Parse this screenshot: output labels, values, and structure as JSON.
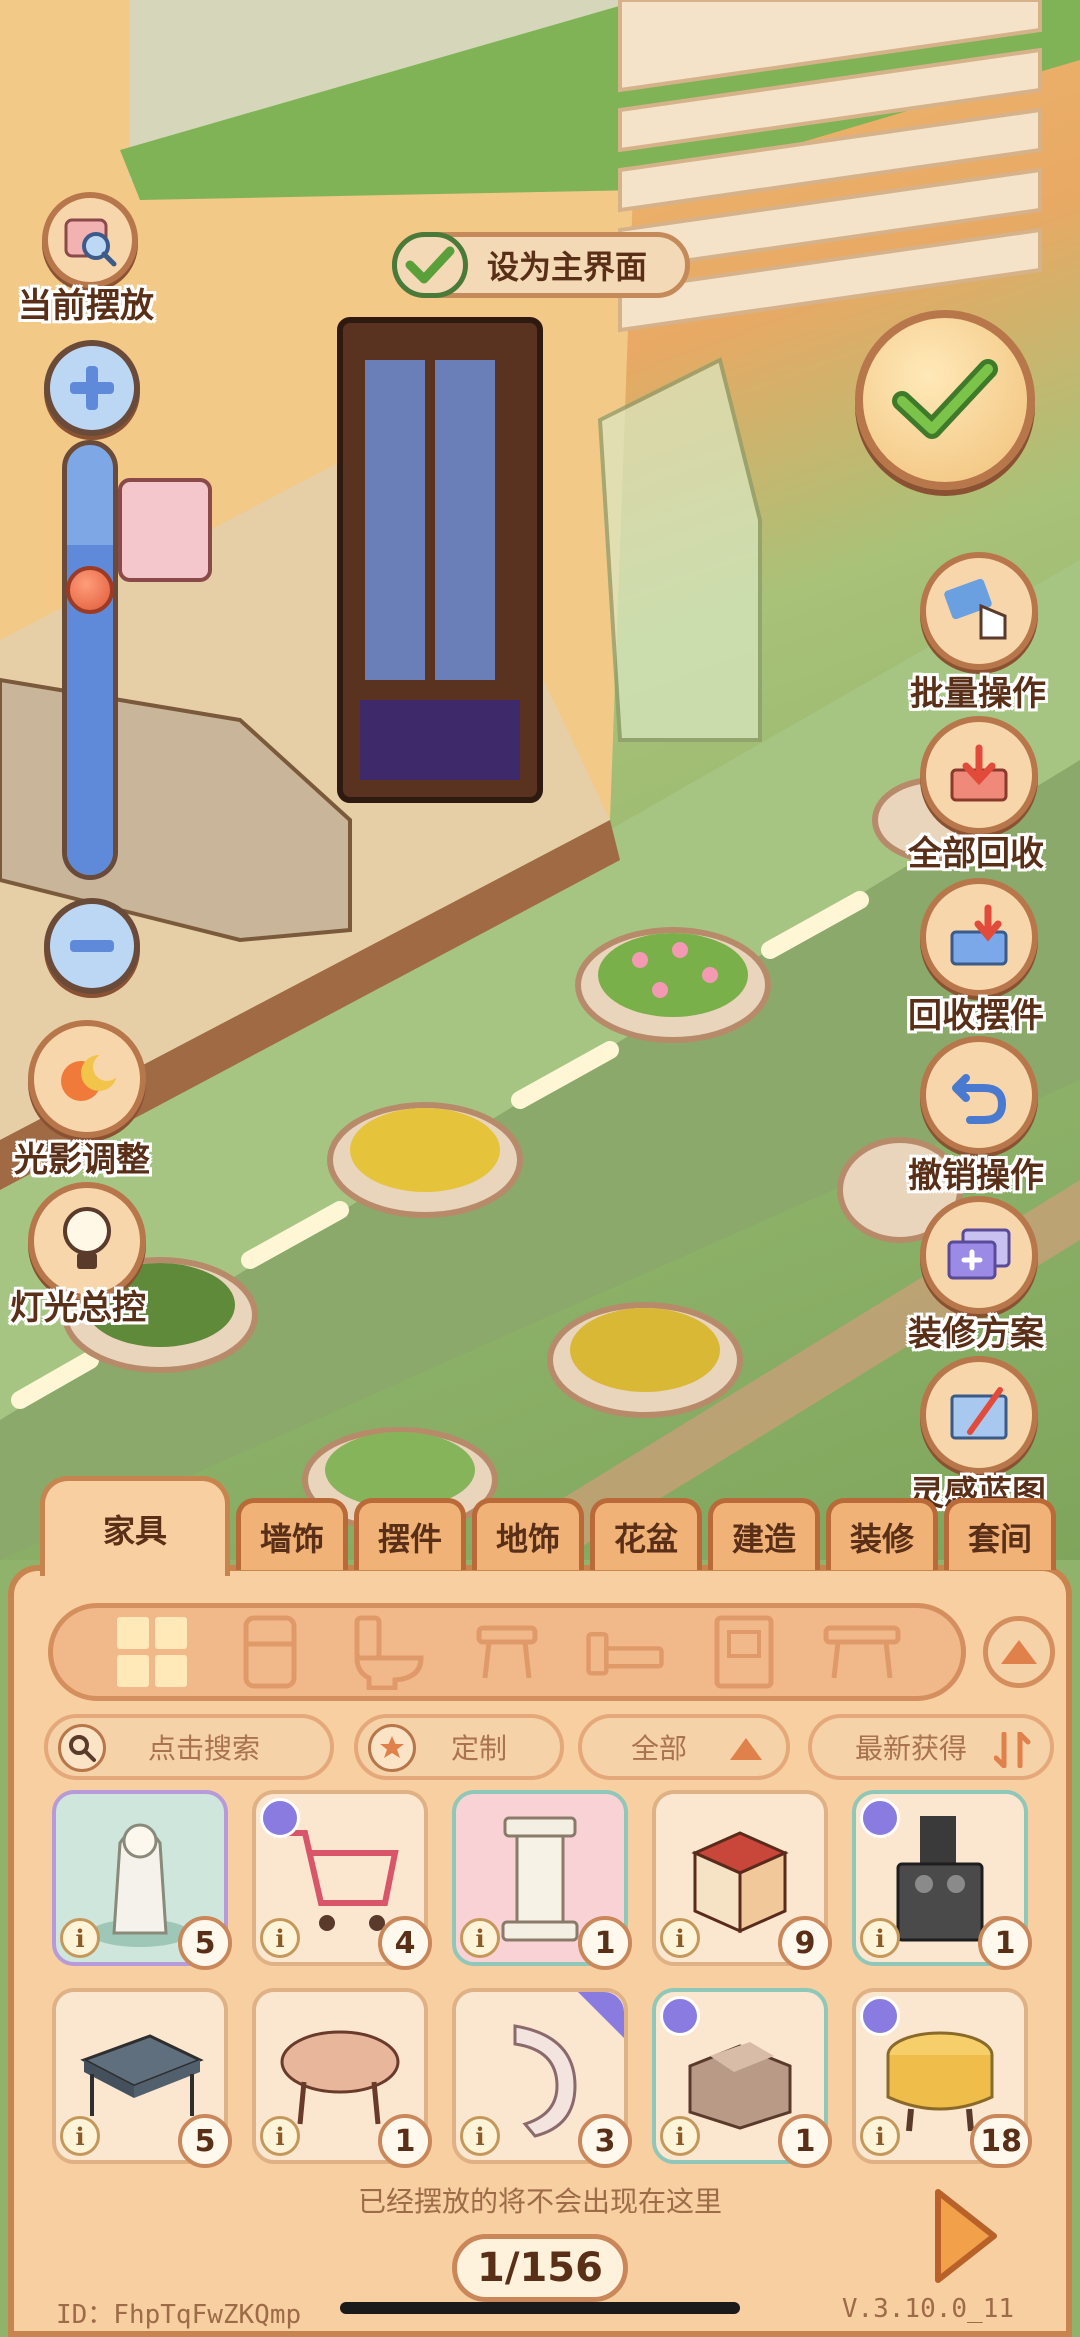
{
  "main_screen_toggle": {
    "label": "设为主界面",
    "checked": true
  },
  "left_controls": [
    {
      "id": "current",
      "label": "当前摆放",
      "icon": "magnifier-frame-icon"
    },
    {
      "id": "light_shadow",
      "label": "光影调整",
      "icon": "sun-moon-icon"
    },
    {
      "id": "light_master",
      "label": "灯光总控",
      "icon": "lightbulb-icon"
    }
  ],
  "zoom": {
    "level": 0.75
  },
  "right_controls": [
    {
      "id": "batch",
      "label": "批量操作",
      "icon": "hand-select-icon"
    },
    {
      "id": "recycle_all",
      "label": "全部回收",
      "icon": "recycle-tray-icon"
    },
    {
      "id": "recycle_item",
      "label": "回收摆件",
      "icon": "box-down-icon"
    },
    {
      "id": "undo",
      "label": "撤销操作",
      "icon": "undo-arrow-icon"
    },
    {
      "id": "plans",
      "label": "装修方案",
      "icon": "plan-cards-icon"
    },
    {
      "id": "inspiration",
      "label": "灵感蓝图",
      "icon": "blueprint-icon"
    }
  ],
  "tabs": [
    "家具",
    "墙饰",
    "摆件",
    "地饰",
    "花盆",
    "建造",
    "装修",
    "套间"
  ],
  "active_tab": 0,
  "category_icons": [
    "grid-icon",
    "fridge-icon",
    "toilet-icon",
    "stool-icon",
    "bed-icon",
    "cabinet-icon",
    "table-icon"
  ],
  "filters": {
    "search_placeholder": "点击搜索",
    "custom": "定制",
    "all": "全部",
    "sort": "最新获得"
  },
  "items": [
    {
      "name": "angel-statue",
      "count": "5",
      "bg": "#cfe6dc",
      "border": "#b79ad9"
    },
    {
      "name": "shopping-cart",
      "count": "4",
      "bg": "#fbe7d0",
      "border": "#e0b184"
    },
    {
      "name": "pillar",
      "count": "1",
      "bg": "#f9d2d6",
      "border": "#8fc7b8"
    },
    {
      "name": "cube-table",
      "count": "9",
      "bg": "#fbe7d0",
      "border": "#e0b184"
    },
    {
      "name": "stove",
      "count": "1",
      "bg": "#fbe7d0",
      "border": "#8fc7b8"
    },
    {
      "name": "grey-table",
      "count": "5",
      "bg": "#fbe7d0",
      "border": "#e0b184"
    },
    {
      "name": "bean-table",
      "count": "1",
      "bg": "#fbe7d0",
      "border": "#e0b184"
    },
    {
      "name": "curved-panel",
      "count": "3",
      "bg": "#fbe7d0",
      "border": "#e0b184"
    },
    {
      "name": "armchair",
      "count": "1",
      "bg": "#fbe7d0",
      "border": "#8fc7b8"
    },
    {
      "name": "yellow-stool",
      "count": "18",
      "bg": "#fbe7d0",
      "border": "#e0b184"
    }
  ],
  "info_glyph": "i",
  "hint": "已经摆放的将不会出现在这里",
  "page": "1/156",
  "user_id": "ID：FhpTqFwZKQmp",
  "version": "V.3.10.0_11"
}
